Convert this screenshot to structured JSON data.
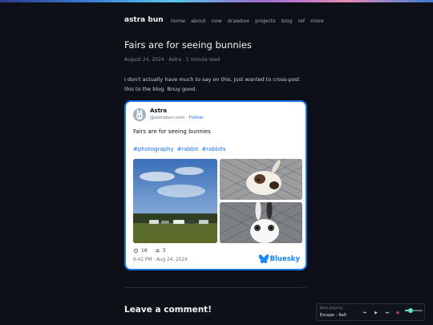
{
  "site": {
    "title": "astra bun"
  },
  "nav": [
    "home",
    "about",
    "now",
    "drawbox",
    "projects",
    "blog",
    "ref",
    "more"
  ],
  "post": {
    "title": "Fairs are for seeing bunnies",
    "meta": "August 24, 2024 · Astra · 1 minute read",
    "body": "I don't actually have much to say on this. Just wanted to cross-post this to the blog. Bnuy good."
  },
  "embed": {
    "author": "Astra",
    "handle": "@astrabun.com",
    "handle_sep": " · ",
    "follow": "Follow",
    "text": "Fairs are for seeing bunnies",
    "tags": [
      "#photography",
      "#rabbit",
      "#rabbits"
    ],
    "likes": "18",
    "reposts": "3",
    "date": "6:42 PM · Aug 24, 2024",
    "brand": "Bluesky",
    "brand_color": "#1185fe",
    "icons": [
      "heart-icon",
      "repost-icon",
      "butterfly-icon"
    ]
  },
  "comments": {
    "heading": "Leave a comment!"
  },
  "player": {
    "label": "Now playing",
    "track": "Escape – 6aS",
    "volume": 0.3,
    "icons": [
      "previous-icon",
      "play-icon",
      "next-icon",
      "record-icon"
    ]
  },
  "colors": {
    "background": "#0d1117",
    "accent": "#1a73e8",
    "slider": "#67e0c7"
  }
}
